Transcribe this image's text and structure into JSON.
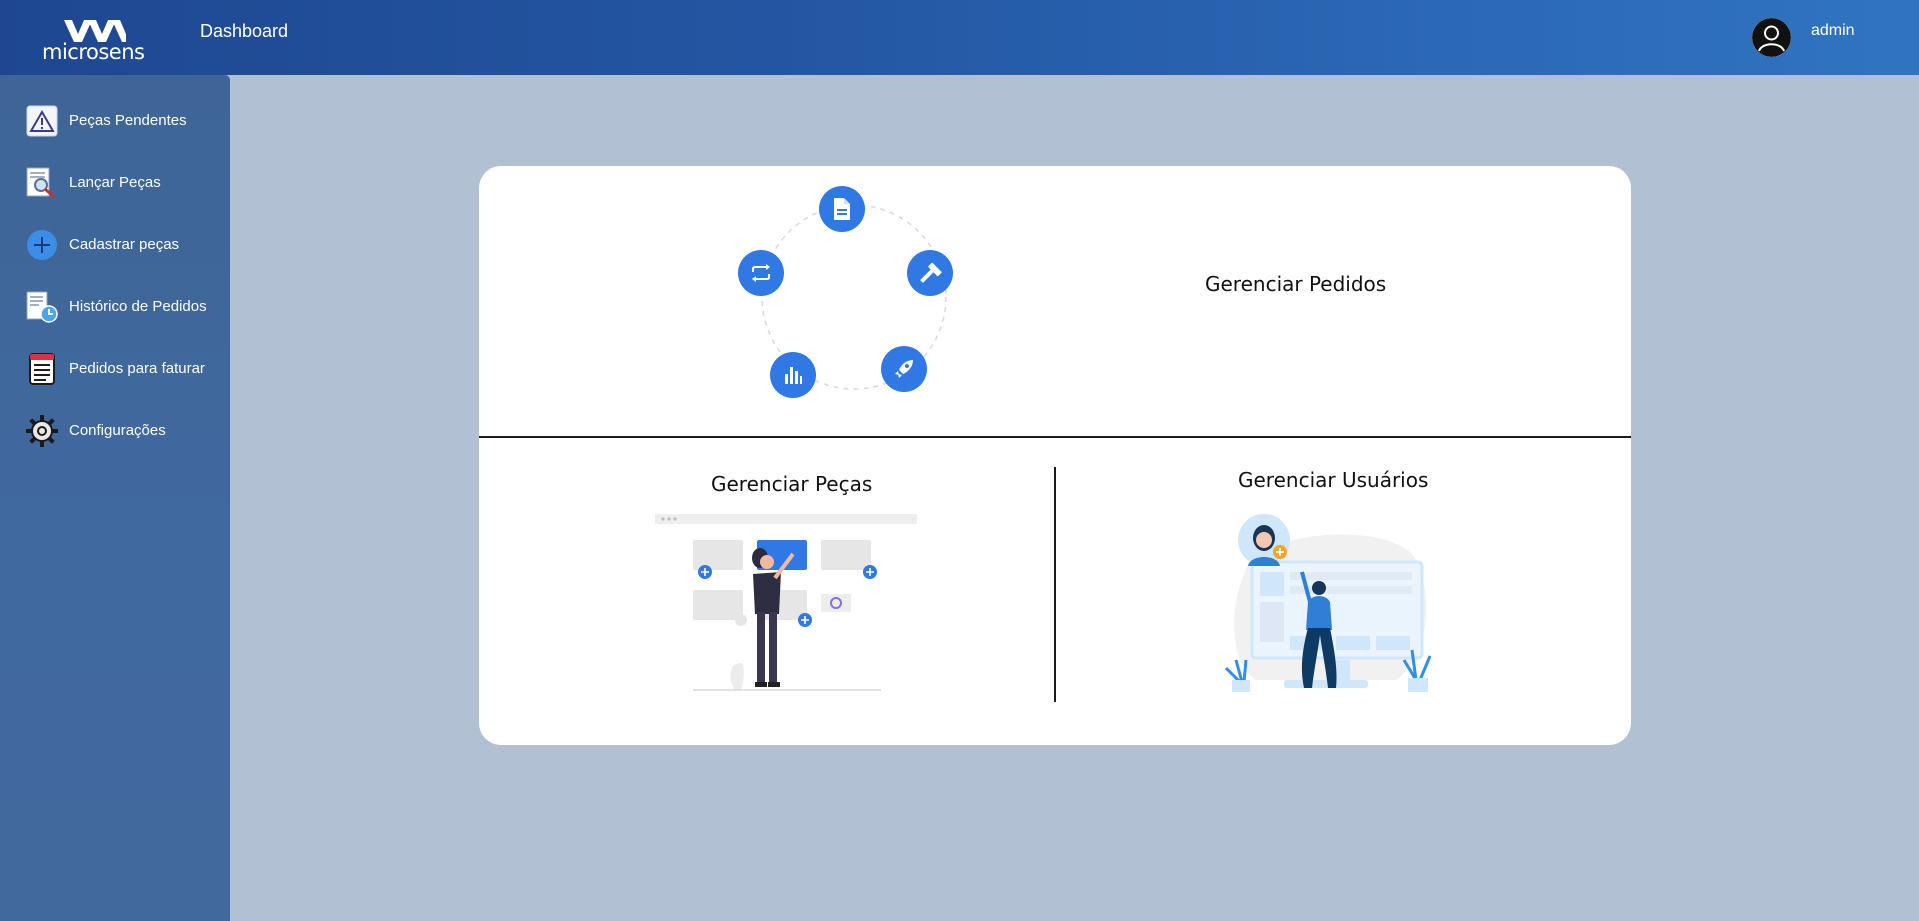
{
  "header": {
    "logo_text": "microsens",
    "title": "Dashboard",
    "username": "admin"
  },
  "sidebar": {
    "items": [
      {
        "label": "Peças Pendentes",
        "icon": "warning-icon"
      },
      {
        "label": "Lançar Peças",
        "icon": "search-document-icon"
      },
      {
        "label": "Cadastrar peças",
        "icon": "plus-circle-icon"
      },
      {
        "label": "Histórico de Pedidos",
        "icon": "history-document-icon"
      },
      {
        "label": "Pedidos para faturar",
        "icon": "invoice-icon"
      },
      {
        "label": "Configurações",
        "icon": "gear-icon"
      }
    ]
  },
  "main": {
    "pedidos_title": "Gerenciar Pedidos",
    "pecas_title": "Gerenciar Peças",
    "usuarios_title": "Gerenciar Usuários"
  },
  "colors": {
    "accent": "#3078e3",
    "header": "#2356a2",
    "sidebar": "#4069a0",
    "background": "#b1c1d3"
  }
}
